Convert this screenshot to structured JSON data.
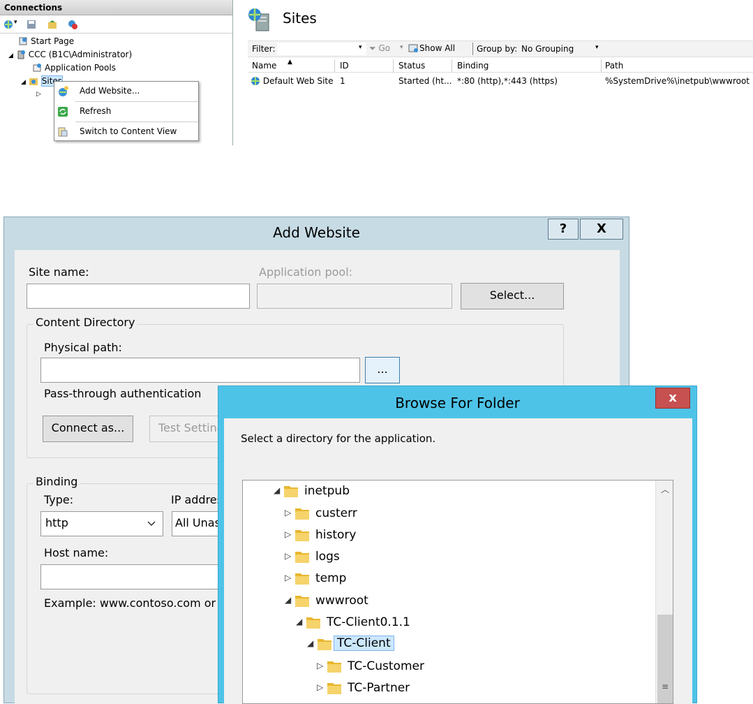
{
  "connections": {
    "title": "Connections",
    "tree": [
      {
        "label": "Start Page"
      },
      {
        "label": "CCC (B1C\\Administrator)"
      },
      {
        "label": "Application Pools"
      },
      {
        "label": "Sites"
      }
    ],
    "context_menu": [
      "Add Website...",
      "Refresh",
      "Switch to Content View"
    ]
  },
  "sites": {
    "title": "Sites",
    "filter_label": "Filter:",
    "go_label": "Go",
    "show_all_label": "Show All",
    "group_by_label": "Group by:",
    "group_by_value": "No Grouping",
    "columns": [
      "Name",
      "ID",
      "Status",
      "Binding",
      "Path"
    ],
    "rows": [
      {
        "name": "Default Web Site",
        "id": "1",
        "status": "Started (ht...",
        "binding": "*:80 (http),*:443 (https)",
        "path": "%SystemDrive%\\inetpub\\wwwroot"
      }
    ]
  },
  "add_website": {
    "title": "Add Website",
    "help": "?",
    "close": "X",
    "site_name_label": "Site name:",
    "app_pool_label": "Application pool:",
    "select_btn": "Select...",
    "content_dir_label": "Content Directory",
    "physical_path_label": "Physical path:",
    "browse_btn": "...",
    "pass_through_label": "Pass-through authentication",
    "connect_as_btn": "Connect as...",
    "test_settings_btn": "Test Setting",
    "binding_label": "Binding",
    "type_label": "Type:",
    "type_value": "http",
    "ip_label": "IP addres",
    "ip_value": "All Unas",
    "host_label": "Host name:",
    "example_text": "Example: www.contoso.com or"
  },
  "browse_folder": {
    "title": "Browse For Folder",
    "close": "x",
    "description": "Select a directory for the application.",
    "nodes": [
      {
        "label": "inetpub",
        "toggle": "◢"
      },
      {
        "label": "custerr",
        "toggle": "▷"
      },
      {
        "label": "history",
        "toggle": "▷"
      },
      {
        "label": "logs",
        "toggle": "▷"
      },
      {
        "label": "temp",
        "toggle": "▷"
      },
      {
        "label": "wwwroot",
        "toggle": "◢"
      },
      {
        "label": "TC-Client0.1.1",
        "toggle": "◢"
      },
      {
        "label": "TC-Client",
        "toggle": "◢"
      },
      {
        "label": "TC-Customer",
        "toggle": "▷"
      },
      {
        "label": "TC-Partner",
        "toggle": "▷"
      }
    ]
  }
}
